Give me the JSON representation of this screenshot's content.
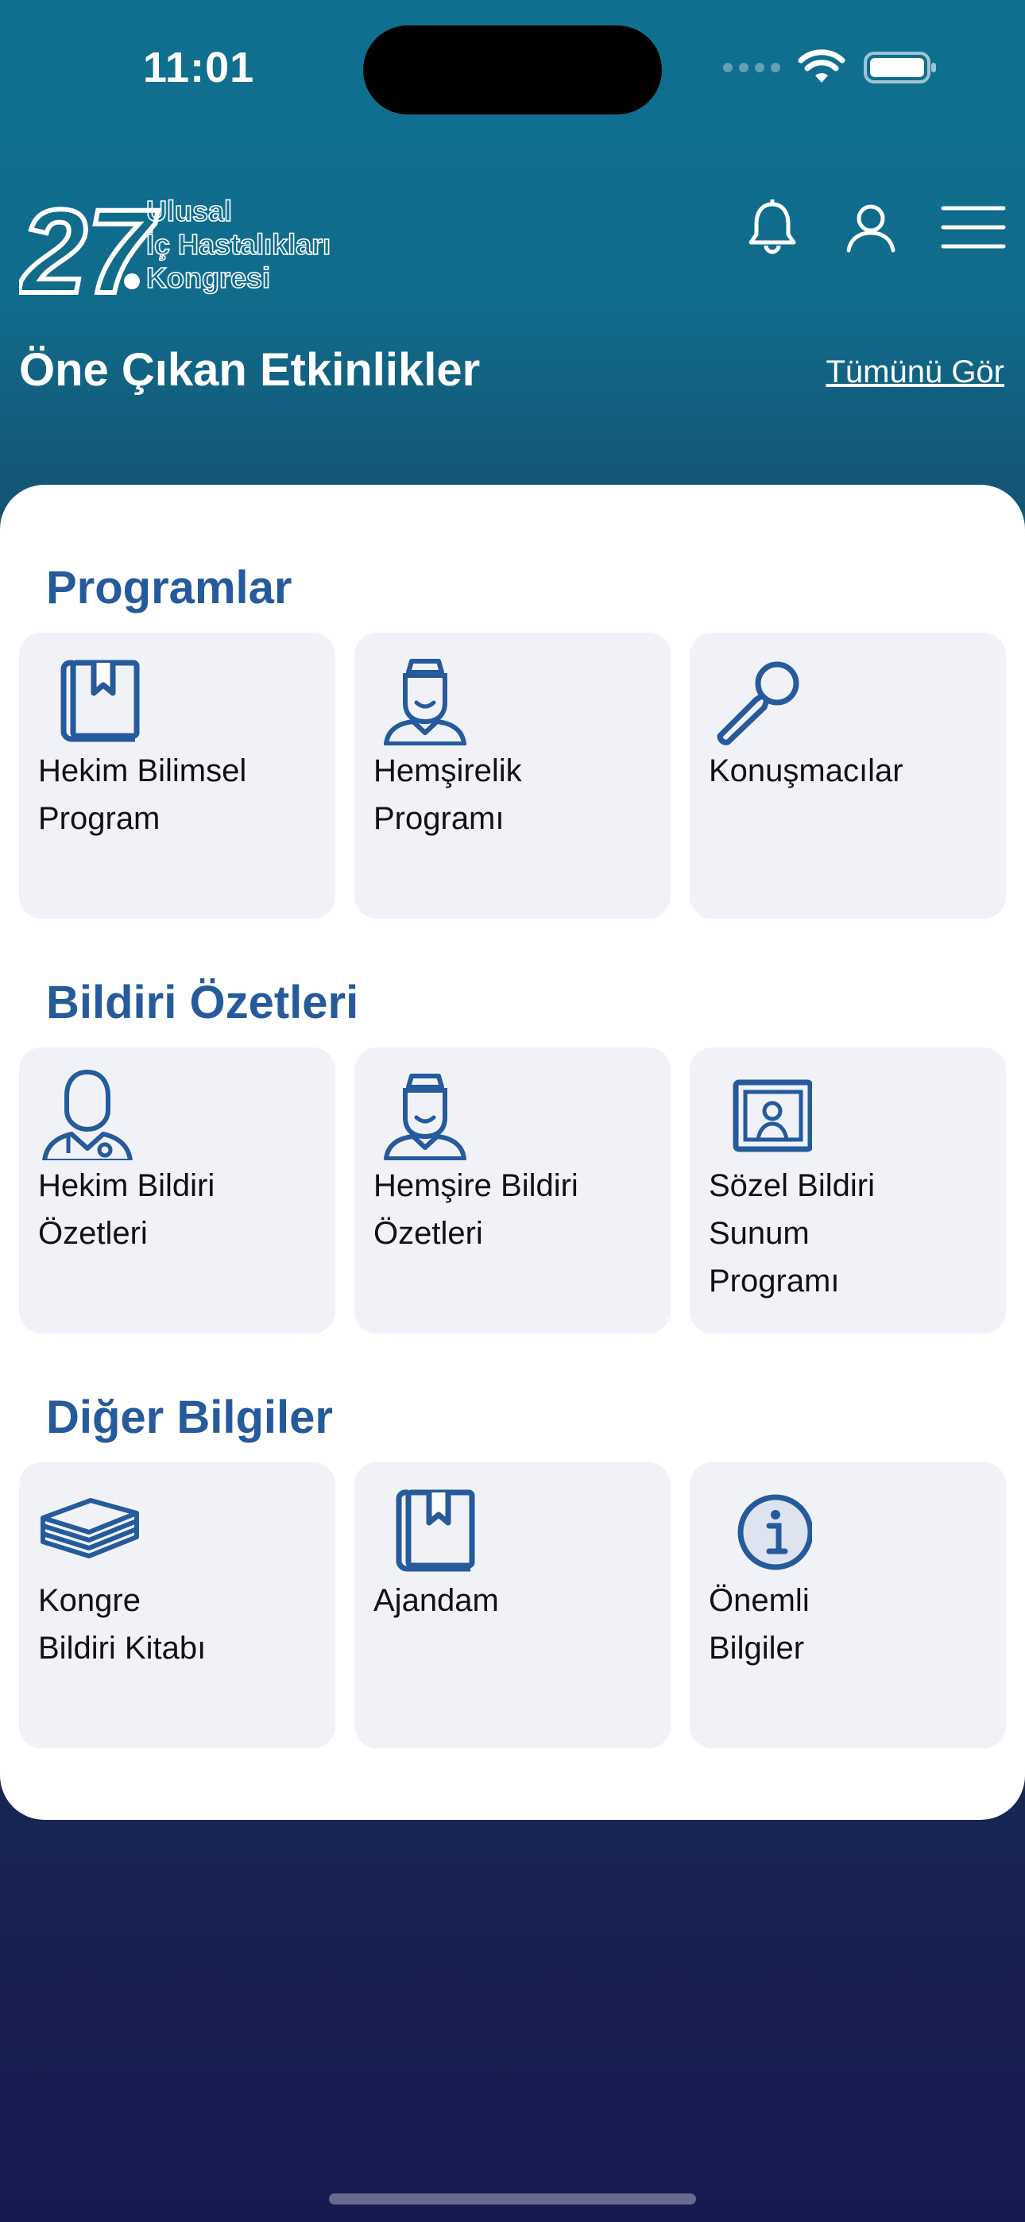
{
  "status_bar": {
    "time": "11:01"
  },
  "logo": {
    "number": "27",
    "line1": "Ulusal",
    "line2": "İç Hastalıkları",
    "line3": "Kongresi"
  },
  "header": {
    "featured_title": "Öne Çıkan Etkinlikler",
    "see_all": "Tümünü Gör"
  },
  "sections": [
    {
      "title": "Programlar",
      "tiles": [
        {
          "icon": "book-icon",
          "label": "Hekim Bilimsel\nProgram"
        },
        {
          "icon": "nurse-icon",
          "label": "Hemşirelik\nProgramı"
        },
        {
          "icon": "microphone-icon",
          "label": "Konuşmacılar"
        }
      ]
    },
    {
      "title": "Bildiri Özetleri",
      "tiles": [
        {
          "icon": "doctor-icon",
          "label": "Hekim Bildiri\nÖzetleri"
        },
        {
          "icon": "nurse-icon",
          "label": "Hemşire Bildiri\nÖzetleri"
        },
        {
          "icon": "presentation-icon",
          "label": "Sözel Bildiri\nSunum\nProgramı"
        }
      ]
    },
    {
      "title": "Diğer Bilgiler",
      "tiles": [
        {
          "icon": "stack-books-icon",
          "label": "Kongre\nBildiri Kitabı"
        },
        {
          "icon": "book-icon",
          "label": "Ajandam"
        },
        {
          "icon": "info-icon",
          "label": "Önemli\nBilgiler"
        }
      ]
    }
  ],
  "colors": {
    "accent": "#255a9c",
    "header_top": "#0f7090",
    "bottom": "#161a50",
    "tile_bg": "#f0f2f8"
  }
}
